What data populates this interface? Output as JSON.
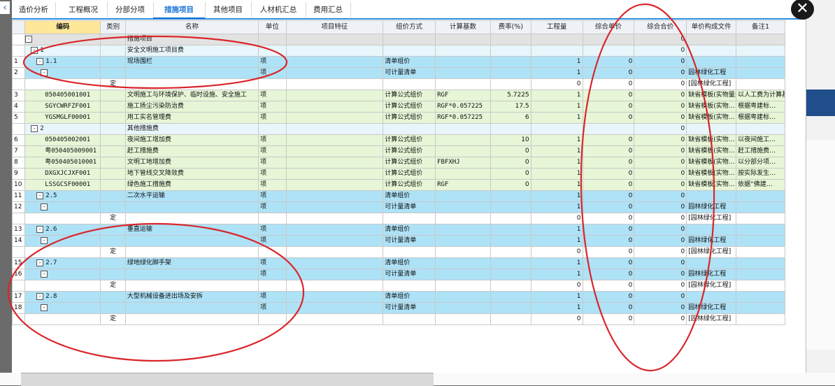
{
  "tabs": [
    "造价分析",
    "工程概况",
    "分部分项",
    "措施项目",
    "其他项目",
    "人材机汇总",
    "费用汇总"
  ],
  "active_tab": "措施项目",
  "columns": [
    "编码",
    "类别",
    "名称",
    "单位",
    "项目特征",
    "组价方式",
    "计算基数",
    "费率(%)",
    "工程量",
    "综合单价",
    "综合合价",
    "单价构成文件",
    "备注1"
  ],
  "rows": [
    {
      "rn": "",
      "toggle": "-",
      "code": "",
      "cat": "",
      "name": "措施项目",
      "unit": "",
      "feat": "",
      "method": "",
      "base": "",
      "rate": "",
      "qty": "",
      "uprice": "",
      "total": "0",
      "file": "",
      "note": ""
    },
    {
      "rn": "",
      "toggle": "-",
      "code": "1",
      "cat": "",
      "name": "安全文明施工项目费",
      "unit": "",
      "feat": "",
      "method": "",
      "base": "",
      "rate": "",
      "qty": "",
      "uprice": "",
      "total": "0",
      "file": "",
      "note": ""
    },
    {
      "rn": "1",
      "toggle": "-",
      "code": "1.1",
      "cat": "",
      "name": "现场围栏",
      "unit": "项",
      "feat": "",
      "method": "清单组价",
      "base": "",
      "rate": "",
      "qty": "1",
      "uprice": "0",
      "total": "0",
      "file": "",
      "note": ""
    },
    {
      "rn": "2",
      "toggle": "-",
      "code": "",
      "cat": "",
      "name": "",
      "unit": "项",
      "feat": "",
      "method": "可计量清单",
      "base": "",
      "rate": "",
      "qty": "1",
      "uprice": "0",
      "total": "0",
      "file": "园林绿化工程",
      "note": ""
    },
    {
      "rn": "",
      "toggle": "",
      "code": "",
      "cat": "定",
      "name": "",
      "unit": "",
      "feat": "",
      "method": "",
      "base": "",
      "rate": "",
      "qty": "0",
      "uprice": "0",
      "total": "0",
      "file": "[园林绿化工程]",
      "note": ""
    },
    {
      "rn": "3",
      "toggle": "",
      "code": "050405001001",
      "cat": "",
      "name": "文明施工与环境保护、临时设施、安全施工",
      "unit": "项",
      "feat": "",
      "method": "计算公式组价",
      "base": "RGF",
      "rate": "5.7225",
      "qty": "1",
      "uprice": "0",
      "total": "0",
      "file": "缺省模板(实物量或计算公式组价)",
      "note": "以人工费为计算基础，费…"
    },
    {
      "rn": "4",
      "toggle": "",
      "code": "SGYCWRFZF001",
      "cat": "",
      "name": "施工扬尘污染防治费",
      "unit": "项",
      "feat": "",
      "method": "计算公式组价",
      "base": "RGF*0.057225",
      "rate": "17.5",
      "qty": "1",
      "uprice": "0",
      "total": "0",
      "file": "缺省模板(实物…",
      "note": "根据粤建标…"
    },
    {
      "rn": "5",
      "toggle": "",
      "code": "YGSMGLF00001",
      "cat": "",
      "name": "用工实名管理费",
      "unit": "项",
      "feat": "",
      "method": "计算公式组价",
      "base": "RGF*0.057225",
      "rate": "6",
      "qty": "1",
      "uprice": "0",
      "total": "0",
      "file": "缺省模板(实物…",
      "note": "根据粤建标…"
    },
    {
      "rn": "",
      "toggle": "-",
      "code": "2",
      "cat": "",
      "name": "其他措施费",
      "unit": "",
      "feat": "",
      "method": "",
      "base": "",
      "rate": "",
      "qty": "",
      "uprice": "",
      "total": "0",
      "file": "",
      "note": ""
    },
    {
      "rn": "6",
      "toggle": "",
      "code": "050405002001",
      "cat": "",
      "name": "夜间施工增加费",
      "unit": "项",
      "feat": "",
      "method": "计算公式组价",
      "base": "",
      "rate": "10",
      "qty": "1",
      "uprice": "0",
      "total": "0",
      "file": "缺省模板(实物…",
      "note": "以夜间施工…"
    },
    {
      "rn": "7",
      "toggle": "",
      "code": "粤050405009001",
      "cat": "",
      "name": "赶工措施费",
      "unit": "项",
      "feat": "",
      "method": "计算公式组价",
      "base": "",
      "rate": "0",
      "qty": "1",
      "uprice": "0",
      "total": "0",
      "file": "缺省模板(实物…",
      "note": "赶工措施费…"
    },
    {
      "rn": "8",
      "toggle": "",
      "code": "粤050405010001",
      "cat": "",
      "name": "文明工地增加费",
      "unit": "项",
      "feat": "",
      "method": "计算公式组价",
      "base": "FBFXHJ",
      "rate": "0",
      "qty": "1",
      "uprice": "0",
      "total": "0",
      "file": "缺省模板(实物…",
      "note": "以分部分项…"
    },
    {
      "rn": "9",
      "toggle": "",
      "code": "DXGXJCJXF001",
      "cat": "",
      "name": "地下管线交叉降效费",
      "unit": "项",
      "feat": "",
      "method": "计算公式组价",
      "base": "",
      "rate": "0",
      "qty": "1",
      "uprice": "0",
      "total": "0",
      "file": "缺省模板(实物…",
      "note": "按实际发生…"
    },
    {
      "rn": "10",
      "toggle": "",
      "code": "LSSGCSF00001",
      "cat": "",
      "name": "绿色施工措施费",
      "unit": "项",
      "feat": "",
      "method": "计算公式组价",
      "base": "RGF",
      "rate": "0",
      "qty": "1",
      "uprice": "0",
      "total": "0",
      "file": "缺省模板(实物…",
      "note": "依据“佛建…"
    },
    {
      "rn": "11",
      "toggle": "-",
      "code": "2.5",
      "cat": "",
      "name": "二次水平运输",
      "unit": "项",
      "feat": "",
      "method": "清单组价",
      "base": "",
      "rate": "",
      "qty": "1",
      "uprice": "0",
      "total": "0",
      "file": "",
      "note": ""
    },
    {
      "rn": "12",
      "toggle": "-",
      "code": "",
      "cat": "",
      "name": "",
      "unit": "项",
      "feat": "",
      "method": "可计量清单",
      "base": "",
      "rate": "",
      "qty": "1",
      "uprice": "0",
      "total": "0",
      "file": "园林绿化工程",
      "note": ""
    },
    {
      "rn": "",
      "toggle": "",
      "code": "",
      "cat": "定",
      "name": "",
      "unit": "",
      "feat": "",
      "method": "",
      "base": "",
      "rate": "",
      "qty": "0",
      "uprice": "0",
      "total": "0",
      "file": "[园林绿化工程]",
      "note": ""
    },
    {
      "rn": "13",
      "toggle": "-",
      "code": "2.6",
      "cat": "",
      "name": "垂直运输",
      "unit": "项",
      "feat": "",
      "method": "清单组价",
      "base": "",
      "rate": "",
      "qty": "1",
      "uprice": "0",
      "total": "0",
      "file": "",
      "note": ""
    },
    {
      "rn": "14",
      "toggle": "-",
      "code": "",
      "cat": "",
      "name": "",
      "unit": "项",
      "feat": "",
      "method": "可计量清单",
      "base": "",
      "rate": "",
      "qty": "1",
      "uprice": "0",
      "total": "0",
      "file": "园林绿化工程",
      "note": ""
    },
    {
      "rn": "",
      "toggle": "",
      "code": "",
      "cat": "定",
      "name": "",
      "unit": "",
      "feat": "",
      "method": "",
      "base": "",
      "rate": "",
      "qty": "0",
      "uprice": "0",
      "total": "0",
      "file": "[园林绿化工程]",
      "note": ""
    },
    {
      "rn": "15",
      "toggle": "-",
      "code": "2.7",
      "cat": "",
      "name": "绿地绿化脚手架",
      "unit": "项",
      "feat": "",
      "method": "清单组价",
      "base": "",
      "rate": "",
      "qty": "1",
      "uprice": "0",
      "total": "0",
      "file": "",
      "note": ""
    },
    {
      "rn": "16",
      "toggle": "-",
      "code": "",
      "cat": "",
      "name": "",
      "unit": "项",
      "feat": "",
      "method": "可计量清单",
      "base": "",
      "rate": "",
      "qty": "1",
      "uprice": "0",
      "total": "0",
      "file": "园林绿化工程",
      "note": ""
    },
    {
      "rn": "",
      "toggle": "",
      "code": "",
      "cat": "定",
      "name": "",
      "unit": "",
      "feat": "",
      "method": "",
      "base": "",
      "rate": "",
      "qty": "0",
      "uprice": "0",
      "total": "0",
      "file": "[园林绿化工程]",
      "note": ""
    },
    {
      "rn": "17",
      "toggle": "-",
      "code": "2.8",
      "cat": "",
      "name": "大型机械设备进出场及安拆",
      "unit": "项",
      "feat": "",
      "method": "清单组价",
      "base": "",
      "rate": "",
      "qty": "1",
      "uprice": "0",
      "total": "0",
      "file": "",
      "note": ""
    },
    {
      "rn": "18",
      "toggle": "-",
      "code": "",
      "cat": "",
      "name": "",
      "unit": "项",
      "feat": "",
      "method": "可计量清单",
      "base": "",
      "rate": "",
      "qty": "1",
      "uprice": "0",
      "total": "0",
      "file": "园林绿化工程",
      "note": ""
    },
    {
      "rn": "",
      "toggle": "",
      "code": "",
      "cat": "定",
      "name": "",
      "unit": "",
      "feat": "",
      "method": "",
      "base": "",
      "rate": "",
      "qty": "0",
      "uprice": "0",
      "total": "0",
      "file": "[园林绿化工程]",
      "note": ""
    }
  ],
  "colors": {
    "accent": "#1a73d8",
    "annotation": "#d9262a",
    "row_blue": "#aee2f7",
    "row_green": "#e6f6d6"
  },
  "icons": {
    "close": "close-icon",
    "back": "chevron-left-icon"
  }
}
